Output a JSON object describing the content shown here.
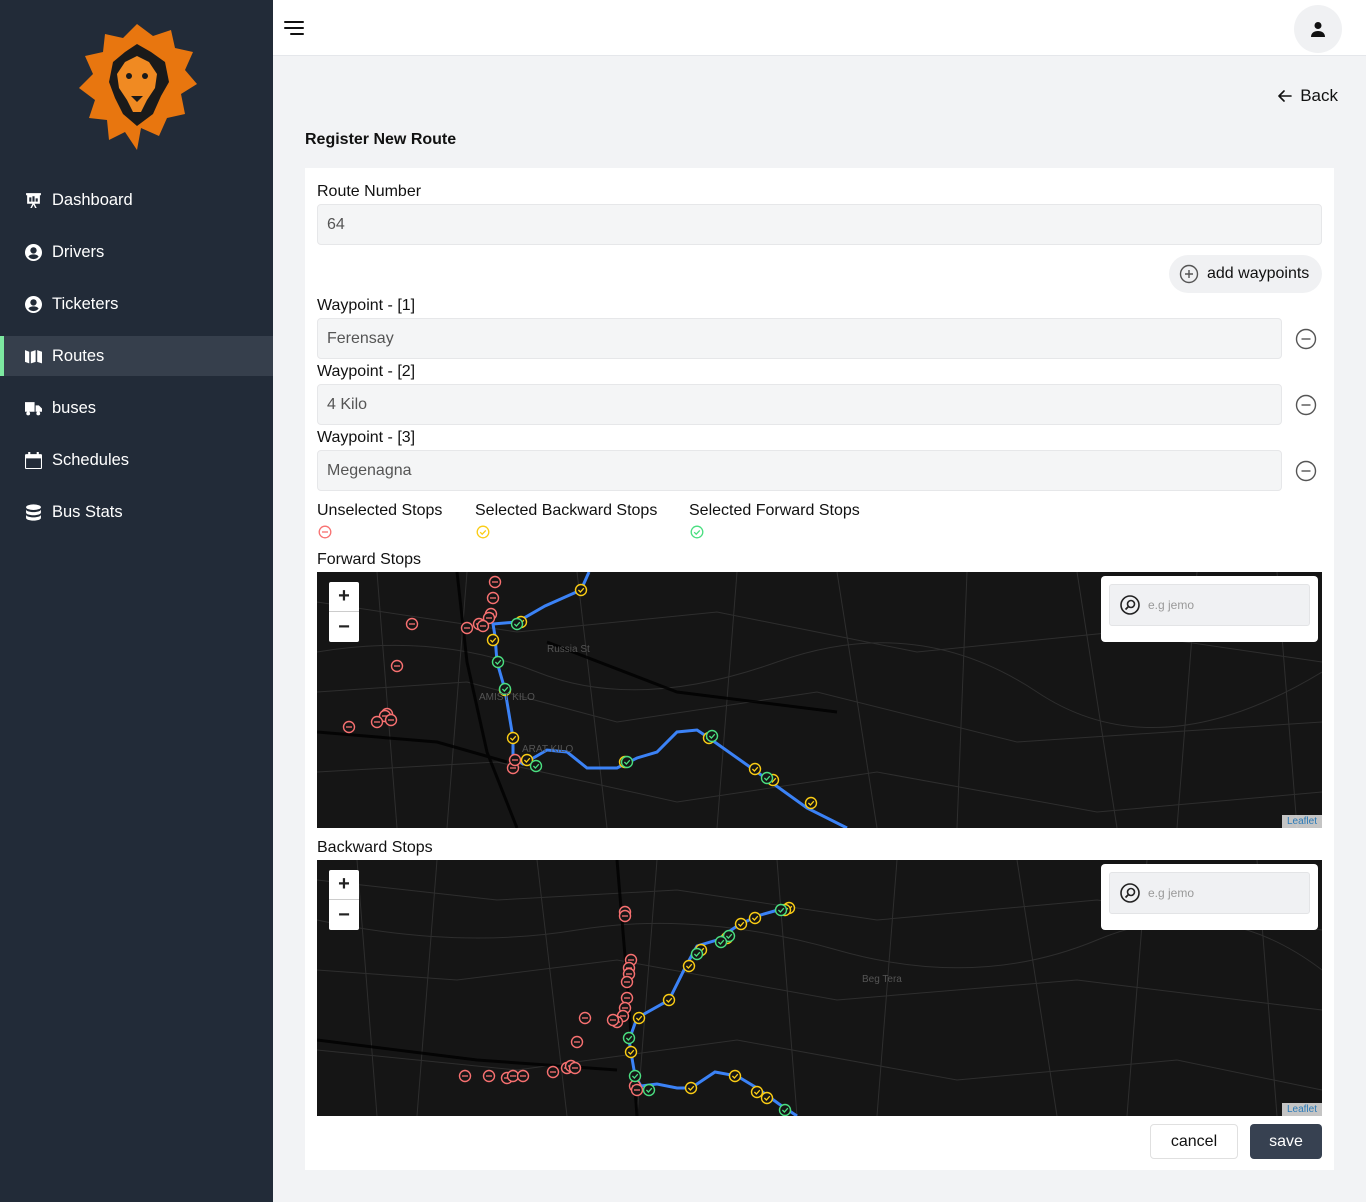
{
  "sidebar": {
    "items": [
      {
        "label": "Dashboard",
        "icon": "dashboard-icon"
      },
      {
        "label": "Drivers",
        "icon": "user-circle-icon"
      },
      {
        "label": "Ticketers",
        "icon": "user-circle-icon"
      },
      {
        "label": "Routes",
        "icon": "map-icon",
        "active": true
      },
      {
        "label": "buses",
        "icon": "truck-icon"
      },
      {
        "label": "Schedules",
        "icon": "calendar-icon"
      },
      {
        "label": "Bus Stats",
        "icon": "database-icon"
      }
    ]
  },
  "header": {
    "back_label": "Back"
  },
  "page": {
    "title": "Register New Route"
  },
  "form": {
    "route_number_label": "Route Number",
    "route_number_value": "64",
    "add_waypoints_label": "add waypoints",
    "waypoints": [
      {
        "label": "Waypoint - [1]",
        "value": "Ferensay"
      },
      {
        "label": "Waypoint - [2]",
        "value": "4 Kilo"
      },
      {
        "label": "Waypoint - [3]",
        "value": "Megenagna"
      }
    ]
  },
  "legend": {
    "unselected": "Unselected Stops",
    "backward": "Selected Backward Stops",
    "forward": "Selected Forward Stops"
  },
  "maps": {
    "forward_label": "Forward Stops",
    "backward_label": "Backward Stops",
    "search_placeholder": "e.g jemo",
    "attribution": "Leaflet",
    "zoom_in": "+",
    "zoom_out": "−",
    "forward_place_labels": [
      "AMIST KILO",
      "ARAT KILO",
      "Russia St"
    ],
    "backward_place_labels": [
      "Beg Tera"
    ]
  },
  "actions": {
    "cancel": "cancel",
    "save": "save"
  },
  "colors": {
    "sidebar_bg": "#222b38",
    "active_accent": "#7de8a0",
    "route_line": "#3b82f6",
    "unselected_stop": "#f87171",
    "backward_stop": "#facc15",
    "forward_stop": "#4ade80"
  }
}
